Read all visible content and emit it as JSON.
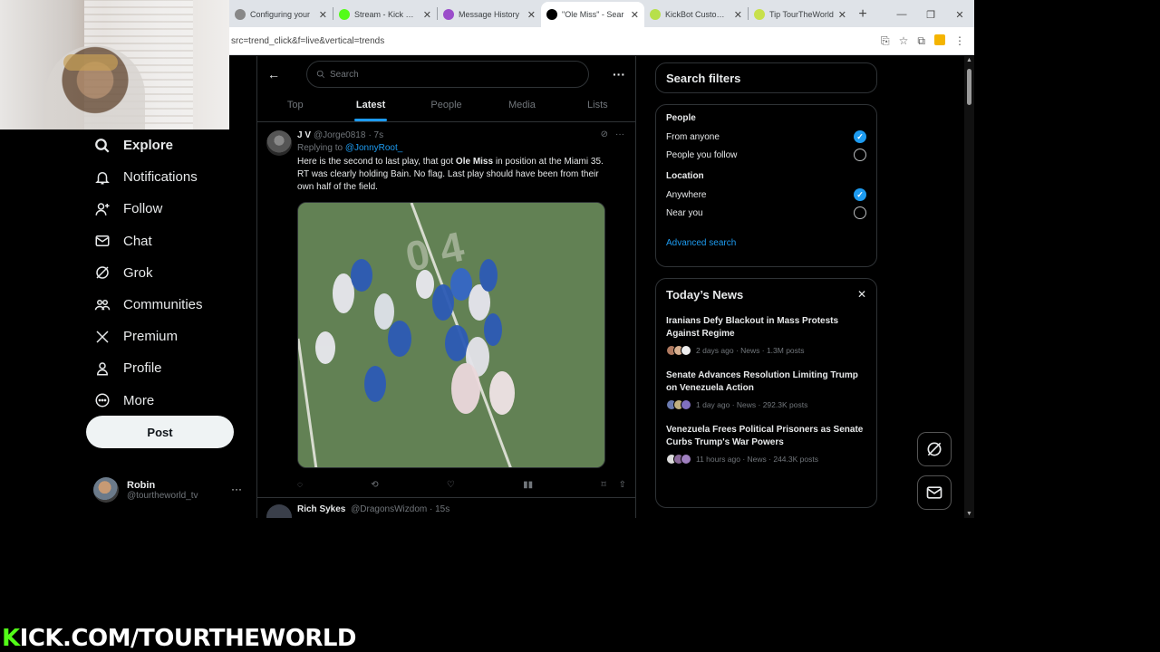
{
  "browser": {
    "tabs": [
      {
        "title": "Configuring your",
        "color": "#888888"
      },
      {
        "title": "Stream - Kick Das",
        "color": "#53fc18"
      },
      {
        "title": "Message History",
        "color": "#9b4dca"
      },
      {
        "title": "\"Ole Miss\" - Sear",
        "color": "#000000",
        "active": true
      },
      {
        "title": "KickBot Custom C",
        "color": "#b7e04a"
      },
      {
        "title": "Tip TourTheWorld",
        "color": "#c8e04a"
      }
    ],
    "new_tab": "+",
    "url": "src=trend_click&f=live&vertical=trends"
  },
  "nav": {
    "items": [
      {
        "label": "Explore",
        "icon": "search-icon"
      },
      {
        "label": "Notifications",
        "icon": "bell-icon"
      },
      {
        "label": "Follow",
        "icon": "add-person-icon"
      },
      {
        "label": "Chat",
        "icon": "mail-icon"
      },
      {
        "label": "Grok",
        "icon": "grok-icon"
      },
      {
        "label": "Communities",
        "icon": "people-icon"
      },
      {
        "label": "Premium",
        "icon": "x-logo-icon"
      },
      {
        "label": "Profile",
        "icon": "person-icon"
      },
      {
        "label": "More",
        "icon": "more-circle-icon"
      }
    ],
    "post_label": "Post",
    "account": {
      "name": "Robin",
      "handle": "@tourtheworld_tv"
    }
  },
  "search": {
    "placeholder": "Search"
  },
  "tabs": [
    "Top",
    "Latest",
    "People",
    "Media",
    "Lists"
  ],
  "tweet": {
    "name": "J V",
    "handle": "@Jorge0818",
    "time": "· 7s",
    "replying_prefix": "Replying to",
    "replying_to": "@JonnyRoot_",
    "text_before": "Here is the second to last play, that got ",
    "text_bold": "Ole Miss",
    "text_after": " in position at the Miami 35. RT was clearly holding Bain. No flag. Last play should have been from their own half of the field."
  },
  "next_tweet": {
    "name": "Rich Sykes",
    "handle": "@DragonsWizdom",
    "time": "· 15s"
  },
  "filters": {
    "title": "Search filters",
    "people_label": "People",
    "people_options": [
      {
        "label": "From anyone",
        "checked": true
      },
      {
        "label": "People you follow",
        "checked": false
      }
    ],
    "location_label": "Location",
    "location_options": [
      {
        "label": "Anywhere",
        "checked": true
      },
      {
        "label": "Near you",
        "checked": false
      }
    ],
    "advanced": "Advanced search"
  },
  "news": {
    "title": "Today’s News",
    "items": [
      {
        "headline": "Iranians Defy Blackout in Mass Protests Against Regime",
        "meta": "2 days ago · News · 1.3M posts"
      },
      {
        "headline": "Senate Advances Resolution Limiting Trump on Venezuela Action",
        "meta": "1 day ago · News · 292.3K posts"
      },
      {
        "headline": "Venezuela Frees Political Prisoners as Senate Curbs Trump's War Powers",
        "meta": "11 hours ago · News · 244.3K posts"
      }
    ]
  },
  "banner": {
    "k": "K",
    "rest": "ICK.COM/TOURTHEWORLD"
  },
  "colors": {
    "accent": "#1d9bf0",
    "kick_green": "#53fc18",
    "background": "#000000"
  }
}
